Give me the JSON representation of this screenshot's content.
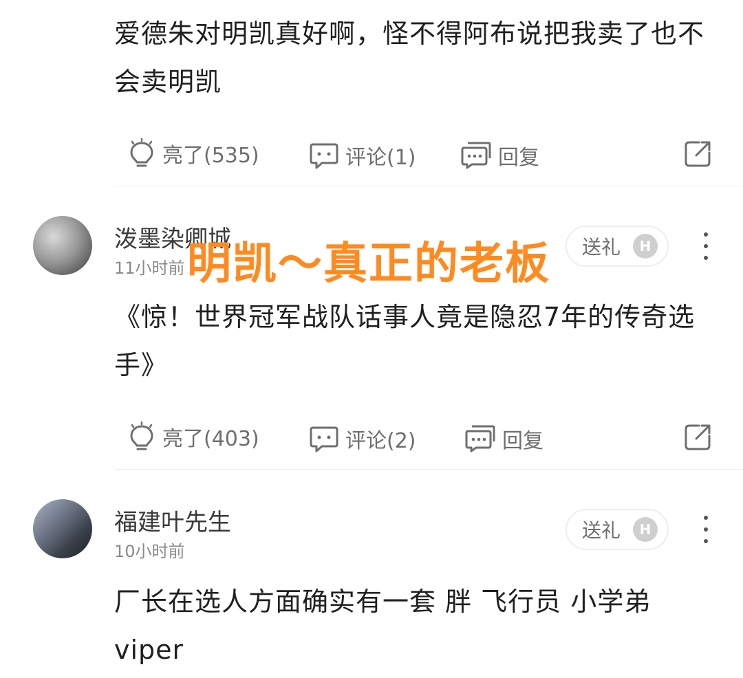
{
  "posts": [
    {
      "content": "爱德朱对明凯真好啊，怪不得阿布说把我卖了也不会卖明凯",
      "actions": {
        "like": "亮了(535)",
        "comment": "评论(1)",
        "reply": "回复"
      }
    },
    {
      "username": "泼墨染卿城",
      "time": "11小时前",
      "gift": "送礼",
      "badge": "H",
      "content": "《惊！世界冠军战队话事人竟是隐忍7年的传奇选手》",
      "actions": {
        "like": "亮了(403)",
        "comment": "评论(2)",
        "reply": "回复"
      }
    },
    {
      "username": "福建叶先生",
      "time": "10小时前",
      "gift": "送礼",
      "badge": "H",
      "content": "厂长在选人方面确实有一套 胖 飞行员 小学弟 viper"
    }
  ],
  "overlay": {
    "title": "明凯～真正的老板"
  }
}
